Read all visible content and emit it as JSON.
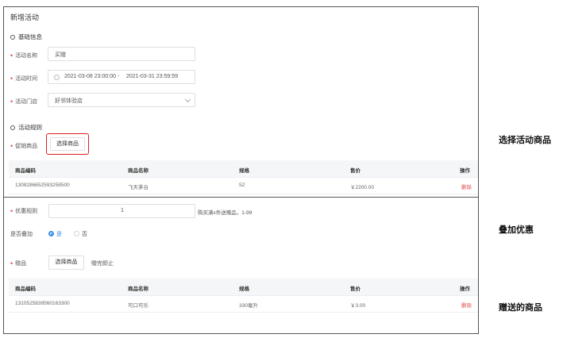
{
  "form": {
    "title": "新增活动",
    "basic_section": "基础信息",
    "name_label": "活动名称",
    "name_value": "买赠",
    "time_label": "活动时间",
    "time_start": "2021-03-08 23:00:00",
    "time_sep": "-",
    "time_end": "2021-03-31 23:59:59",
    "store_label": "活动门店",
    "store_value": "好邻体验店",
    "rules_section": "活动规则",
    "promo_label": "促销商品",
    "select_button": "选择商品"
  },
  "table": {
    "headers": [
      "商品编码",
      "商品名称",
      "规格",
      "售价",
      "操作"
    ],
    "promo_rows": [
      [
        "1308286652593258500",
        "飞天茅台",
        "52",
        "￥2200.00",
        "删除"
      ]
    ],
    "gift_rows": [
      [
        "1310525839560163300",
        "可口可乐",
        "330毫升",
        "￥3.00",
        "删除"
      ]
    ]
  },
  "rules": {
    "discount_label": "优惠规则",
    "discount_value": "1",
    "discount_hint": "购买满x件送赠品，1-99",
    "stack_label": "是否叠加",
    "stack_yes": "是",
    "stack_no": "否",
    "gift_label": "赠品",
    "gift_select_button": "选择商品",
    "gift_hint": "赠完即止"
  },
  "callouts": {
    "select_products": "选择活动商品",
    "stack_discount": "叠加优惠",
    "gift_products": "赠送的商品"
  },
  "colors": {
    "required": "#e34d4d",
    "highlight": "#e02020",
    "radio_active": "#3a8ee6"
  }
}
